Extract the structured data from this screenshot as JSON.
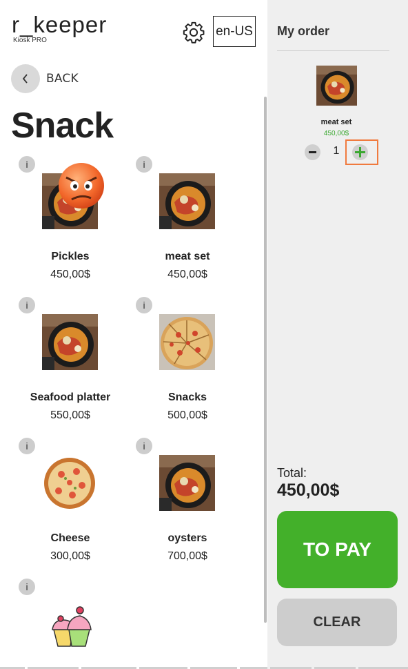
{
  "header": {
    "logo_main": "r_keeper",
    "logo_sub": "Kiosk PRO",
    "language": "en-US"
  },
  "nav": {
    "back_label": "BACK"
  },
  "category": {
    "title": "Snack"
  },
  "products": [
    {
      "name": "Pickles",
      "price": "450,00$",
      "info": "i",
      "image": "soup-bowl"
    },
    {
      "name": "meat set",
      "price": "450,00$",
      "info": "i",
      "image": "soup-bowl"
    },
    {
      "name": "Seafood platter",
      "price": "550,00$",
      "info": "i",
      "image": "soup-bowl"
    },
    {
      "name": "Snacks",
      "price": "500,00$",
      "info": "i",
      "image": "pizza-slices"
    },
    {
      "name": "Cheese",
      "price": "300,00$",
      "info": "i",
      "image": "pizza-whole"
    },
    {
      "name": "oysters",
      "price": "700,00$",
      "info": "i",
      "image": "soup-bowl"
    },
    {
      "name": "",
      "price": "",
      "info": "i",
      "image": "cupcakes"
    }
  ],
  "order": {
    "title": "My order",
    "items": [
      {
        "name": "meat set",
        "price": "450,00$",
        "quantity": "1",
        "image": "soup-bowl"
      }
    ],
    "total_label": "Total:",
    "total_value": "450,00$",
    "pay_label": "TO PAY",
    "clear_label": "CLEAR"
  },
  "overlay": {
    "icon": "angry-face-icon"
  },
  "colors": {
    "accent_green": "#43b02a",
    "price_green": "#3aa830",
    "highlight_orange": "#f07a3e",
    "panel_gray": "#efefef"
  }
}
